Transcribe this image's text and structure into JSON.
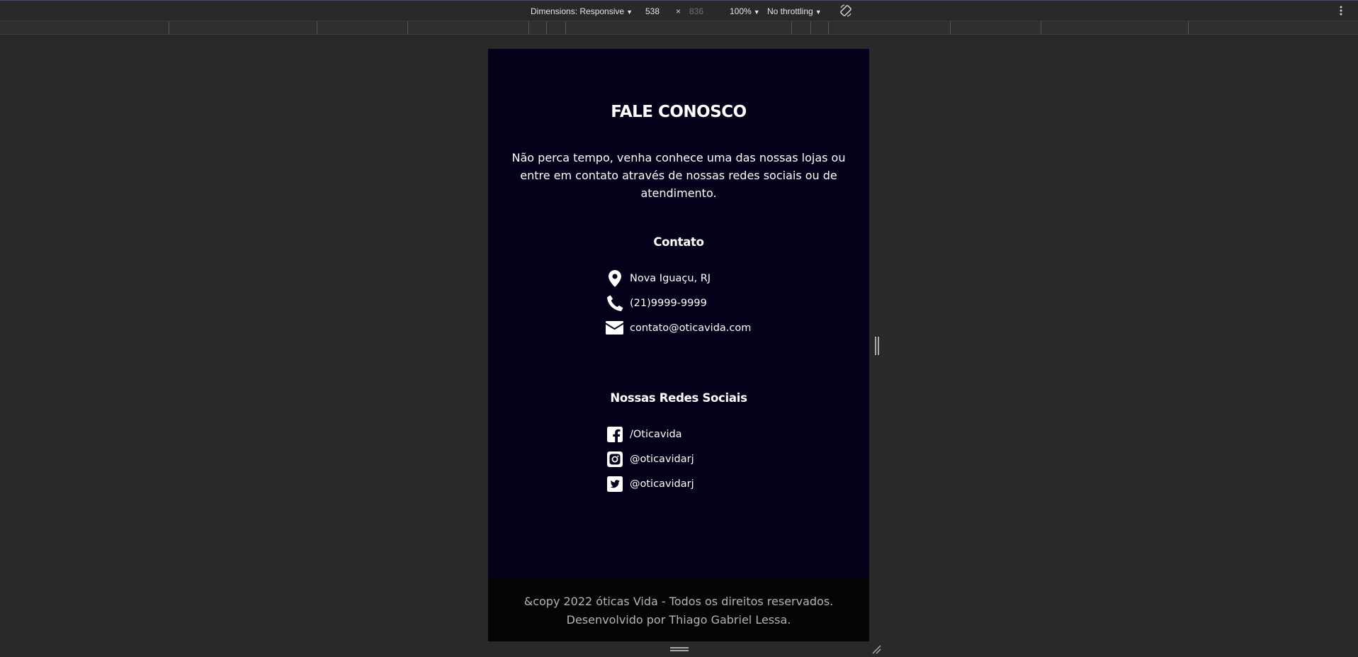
{
  "devtools": {
    "dimensions_label": "Dimensions: Responsive",
    "width": "538",
    "times": "×",
    "height": "836",
    "zoom": "100%",
    "throttling": "No throttling",
    "rotate_icon": "rotate-icon",
    "menu_icon": "kebab-menu-icon"
  },
  "page": {
    "title": "FALE CONOSCO",
    "intro": "Não perca tempo, venha conhece uma das nossas lojas ou entre em contato através de nossas redes sociais ou de atendimento.",
    "contact": {
      "title": "Contato",
      "items": [
        {
          "icon": "location-pin-icon",
          "text": "Nova Iguaçu, RJ"
        },
        {
          "icon": "phone-icon",
          "text": "(21)9999-9999"
        },
        {
          "icon": "envelope-icon",
          "text": "contato@oticavida.com"
        }
      ]
    },
    "social": {
      "title": "Nossas Redes Sociais",
      "items": [
        {
          "icon": "facebook-icon",
          "text": "/Oticavida"
        },
        {
          "icon": "instagram-icon",
          "text": "@oticavidarj"
        },
        {
          "icon": "twitter-icon",
          "text": "@oticavidarj"
        }
      ]
    },
    "footer": {
      "line1": "&copy 2022 óticas Vida - Todos os direitos reservados.",
      "line2": "Desenvolvido por Thiago Gabriel Lessa."
    }
  },
  "colors": {
    "viewport_bg": "#03021a",
    "footer_bg": "#050505",
    "devtools_bg": "#292929"
  }
}
